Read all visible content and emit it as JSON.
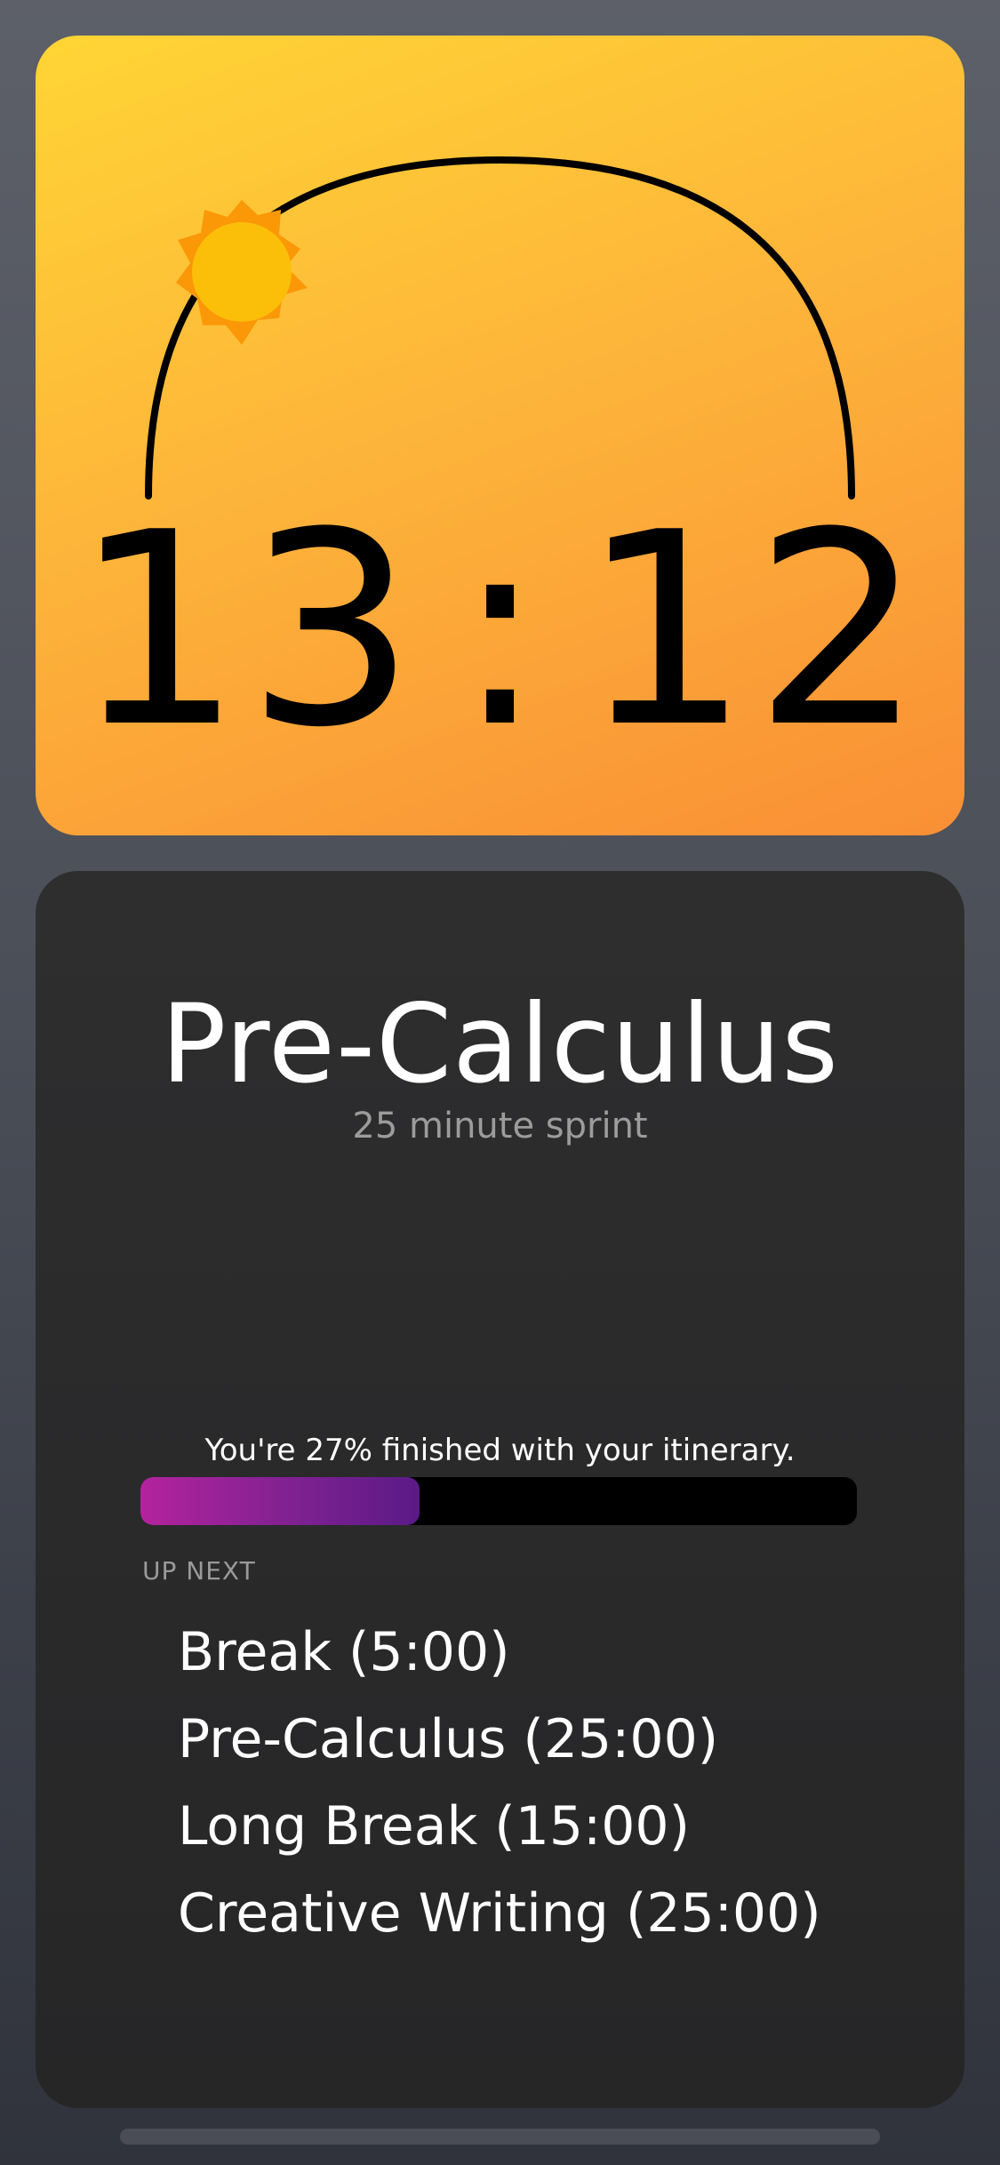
{
  "timer": {
    "minutes": "13",
    "separator": ":",
    "seconds": "12",
    "sun_icon": "sun-icon",
    "colors": {
      "card_top": "#ffd535",
      "card_bottom": "#f98f35",
      "sun_core": "#fbbf09",
      "sun_rays": "#fb9807",
      "arc": "#000000"
    }
  },
  "session": {
    "title": "Pre-Calculus",
    "subtitle": "25 minute sprint"
  },
  "progress": {
    "text": "You're 27% finished with your itinerary.",
    "percent": 39,
    "colors": {
      "fill_start": "#b3239d",
      "fill_end": "#5b1a86",
      "track": "#000000"
    }
  },
  "up_next": {
    "label": "UP NEXT",
    "items": [
      "Break (5:00)",
      "Pre-Calculus (25:00)",
      "Long Break (15:00)",
      "Creative Writing (25:00)"
    ]
  }
}
